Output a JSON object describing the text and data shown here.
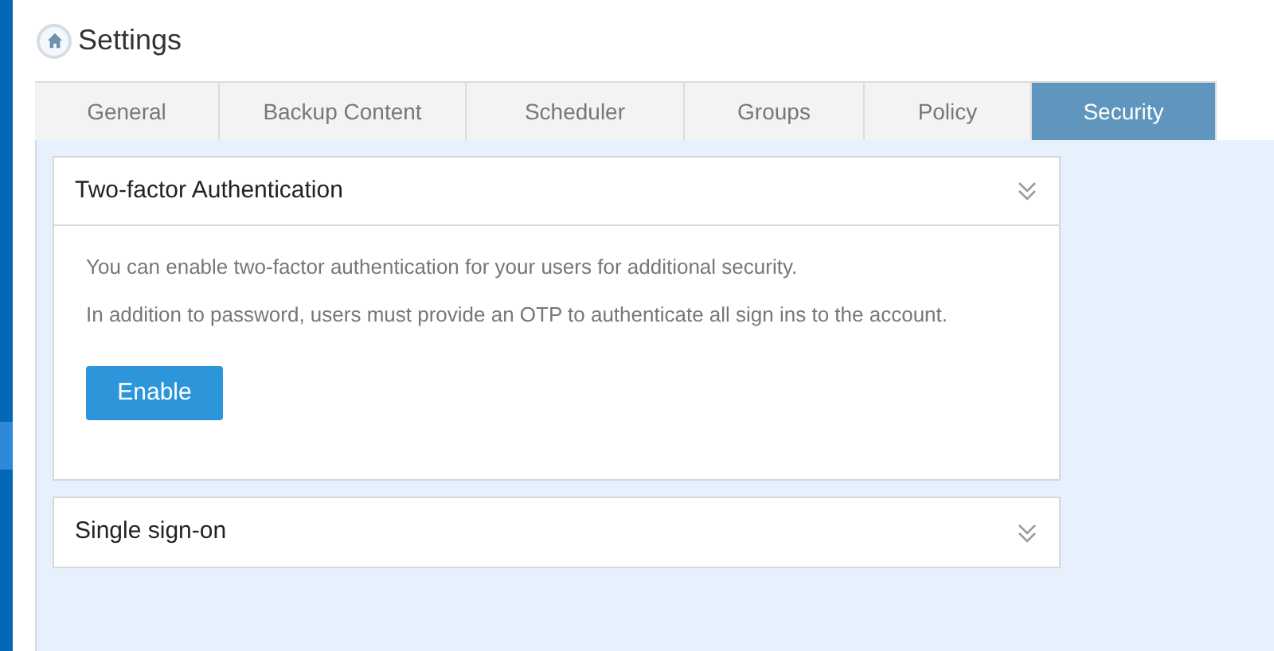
{
  "page": {
    "title": "Settings"
  },
  "tabs": [
    {
      "label": "General",
      "selected": false
    },
    {
      "label": "Backup Content",
      "selected": false
    },
    {
      "label": "Scheduler",
      "selected": false
    },
    {
      "label": "Groups",
      "selected": false
    },
    {
      "label": "Policy",
      "selected": false
    },
    {
      "label": "Security",
      "selected": true
    }
  ],
  "sections": [
    {
      "title": "Two-factor Authentication",
      "expanded": true,
      "paragraphs": [
        "You can enable two-factor authentication for your users for additional security.",
        "In addition to password, users must provide an OTP to authenticate all sign ins to the account."
      ],
      "button": "Enable"
    },
    {
      "title": "Single sign-on",
      "expanded": false
    }
  ]
}
